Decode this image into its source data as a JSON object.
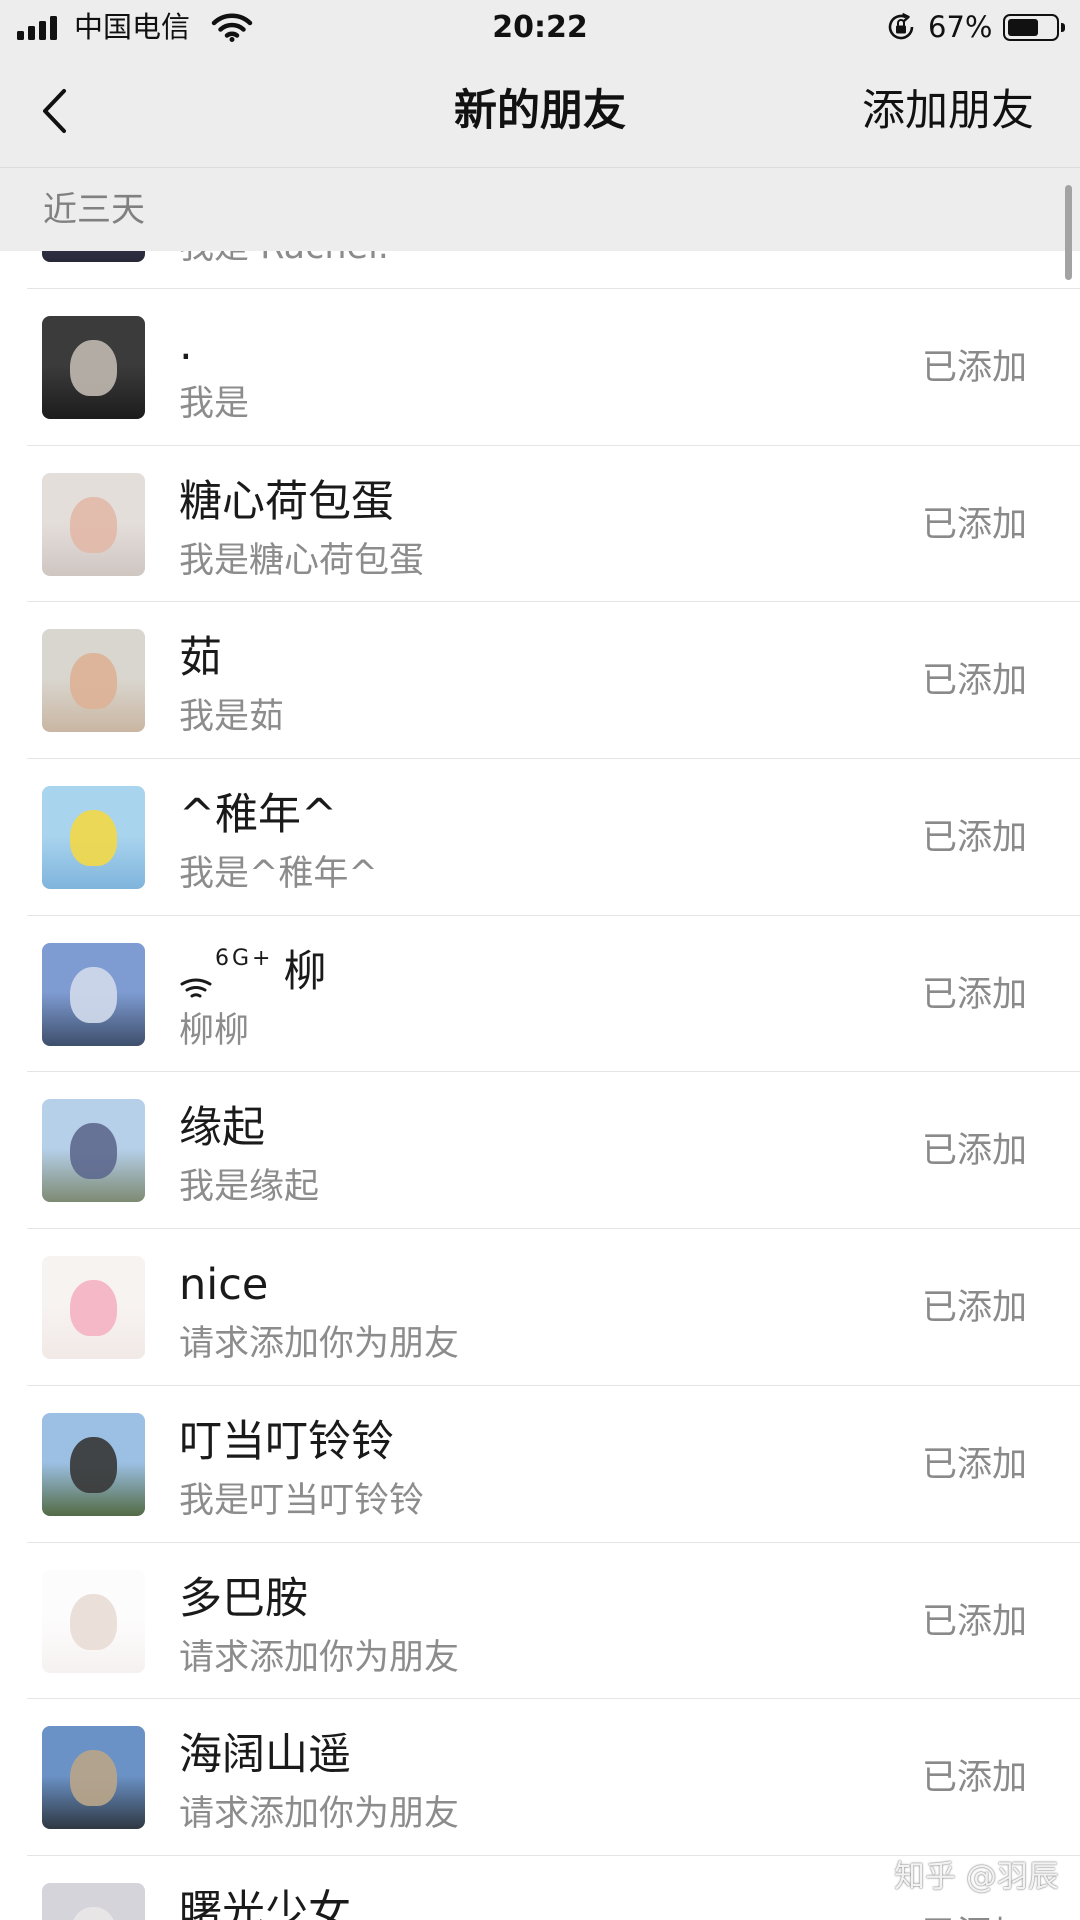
{
  "status_bar": {
    "carrier": "中国电信",
    "time": "20:22",
    "battery_text": "67%",
    "battery_level": 0.67,
    "icons": [
      "signal-icon",
      "wifi-icon",
      "rotation-lock-icon",
      "battery-icon"
    ]
  },
  "nav": {
    "back_icon": "chevron-left-icon",
    "title": "新的朋友",
    "action_label": "添加朋友"
  },
  "section": {
    "label": "近三天"
  },
  "list": {
    "partial_item": {
      "message": "我是 Rachel.",
      "avatar": {
        "a": "#4a4d66",
        "b": "#262838",
        "c": "#3a3c52"
      }
    },
    "items": [
      {
        "name": ".",
        "message": "我是",
        "status": "已添加",
        "avatar": {
          "a": "#3b3b3b",
          "b": "#1c1c1c",
          "c": "#bdb6ae"
        }
      },
      {
        "name": "糖心荷包蛋",
        "message": "我是糖心荷包蛋",
        "status": "已添加",
        "avatar": {
          "a": "#e4dedb",
          "b": "#cfc6c2",
          "c": "#e2b9a8"
        }
      },
      {
        "name": "茹",
        "message": "我是茹",
        "status": "已添加",
        "avatar": {
          "a": "#d9d6cf",
          "b": "#c9b6a2",
          "c": "#dcb296"
        }
      },
      {
        "name": "^稚年^",
        "message": "我是^稚年^",
        "status": "已添加",
        "avatar": {
          "a": "#a9d4ee",
          "b": "#7fb4dc",
          "c": "#f1d84a"
        }
      },
      {
        "name": "柳",
        "name_icon": "wifi-icon",
        "name_superscript": "6G+",
        "message": "柳柳",
        "status": "已添加",
        "avatar": {
          "a": "#7e9bd2",
          "b": "#3e4f6b",
          "c": "#cfd9ea"
        }
      },
      {
        "name": "缘起",
        "message": "我是缘起",
        "status": "已添加",
        "avatar": {
          "a": "#b6d0ea",
          "b": "#7d8a73",
          "c": "#5f6a8f"
        }
      },
      {
        "name": "nice",
        "message": "请求添加你为朋友",
        "status": "已添加",
        "avatar": {
          "a": "#f7f3f1",
          "b": "#f1e9e6",
          "c": "#f4b3c2"
        }
      },
      {
        "name": "叮当叮铃铃",
        "message": "我是叮当叮铃铃",
        "status": "已添加",
        "avatar": {
          "a": "#9cc0e4",
          "b": "#536b45",
          "c": "#3a3a3a"
        }
      },
      {
        "name": "多巴胺",
        "message": "请求添加你为朋友",
        "status": "已添加",
        "avatar": {
          "a": "#fdfcfc",
          "b": "#f6f1f1",
          "c": "#e9dcd6"
        }
      },
      {
        "name": "海阔山遥",
        "message": "请求添加你为朋友",
        "status": "已添加",
        "avatar": {
          "a": "#6b92c7",
          "b": "#2f3842",
          "c": "#b8a58a"
        }
      },
      {
        "name": "曙光少女",
        "status": "已添加",
        "avatar": {
          "a": "#d5d4da",
          "b": "#8d8c94",
          "c": "#e9e6e8"
        }
      }
    ]
  },
  "watermark": {
    "icon": "chat-bubble-icon",
    "text": "知乎 @羽辰"
  },
  "colors": {
    "bar_background": "#ededed",
    "list_background": "#ffffff",
    "divider": "#e5e5e5",
    "primary_text": "#1a1a1a",
    "secondary_text": "#8c8c8c"
  }
}
